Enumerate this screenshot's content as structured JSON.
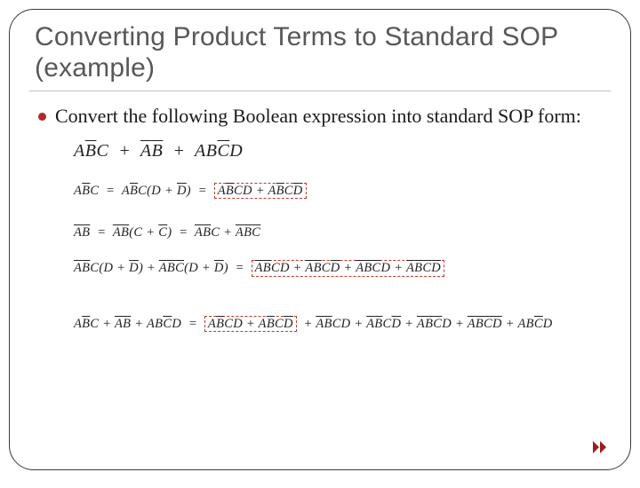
{
  "title": "Converting Product Terms to Standard SOP (example)",
  "bullet": "Convert the following Boolean expression into standard SOP form:",
  "icons": {
    "forward": "double-triangle-right"
  },
  "expressions": {
    "main": "A B̄ C + ĀB̄ + A B C̄ D",
    "step1_lhs": "A B̄ C = A B̄ C ( D + D̄ ) =",
    "step1_box": "A B̄ C D + A B̄ C D̄",
    "step2_line1": "ĀB̄ = ĀB̄ ( C + C̄ ) = ĀB̄C + ĀB̄C̄",
    "step2_line2_lhs": "ĀB̄C ( D + D̄ ) + ĀB̄C̄ ( D + D̄ ) =",
    "step2_line2_box": "ĀB̄CD + ĀB̄CD̄ + ĀB̄C̄D + ĀB̄C̄D̄",
    "final_lhs": "A B̄ C + ĀB̄ + A B C̄ D =",
    "final_box": "A B̄ C D + A B̄ C D̄",
    "final_tail": "+ ĀB̄CD + ĀB̄CD̄ + ĀB̄C̄D + ĀB̄C̄D̄ + A B C̄ D"
  }
}
